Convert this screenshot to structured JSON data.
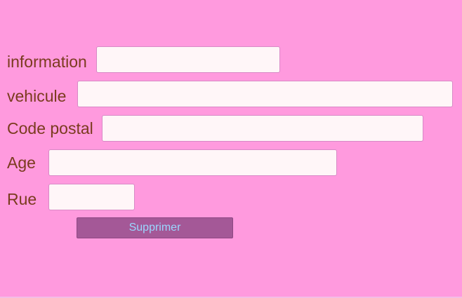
{
  "colors": {
    "page_background": "#ff9ade",
    "label_text": "#7a3b1e",
    "field_background": "#fff6f8",
    "field_border": "#d889c6",
    "button_background": "#a45897",
    "button_text": "#9ad7ff"
  },
  "form": {
    "fields": [
      {
        "label": "information",
        "value": ""
      },
      {
        "label": "vehicule",
        "value": ""
      },
      {
        "label": "Code postal",
        "value": ""
      },
      {
        "label": "Age",
        "value": ""
      },
      {
        "label": "Rue",
        "value": ""
      }
    ],
    "submit_label": "Supprimer"
  }
}
